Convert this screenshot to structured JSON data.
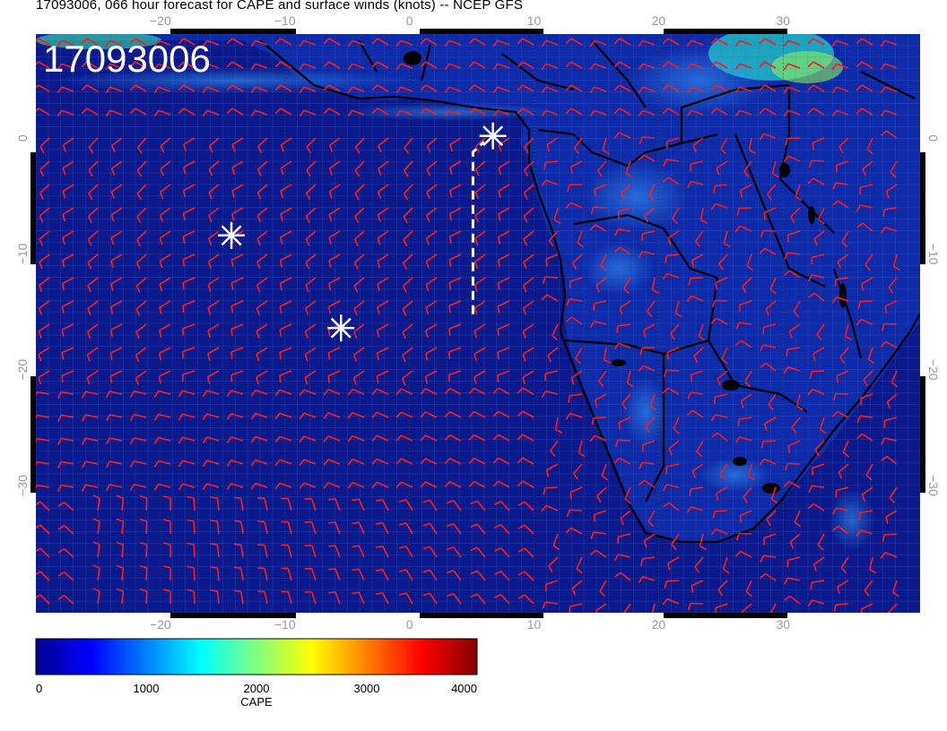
{
  "title": "17093006, 066 hour forecast for CAPE and surface winds (knots) -- NCEP GFS",
  "stamp": "17093006",
  "map": {
    "lon_range": [
      -30,
      41
    ],
    "lat_range": [
      -41,
      9
    ],
    "lon_ticks": [
      "−20",
      "−10",
      "0",
      "10",
      "20",
      "30"
    ],
    "lat_ticks": [
      "0",
      "−10",
      "−20",
      "−30"
    ],
    "ocean_color": "#0a1a8c",
    "land_color": "#0d2aa8",
    "barb_color": "#ff1a1a",
    "coast_color": "#000000",
    "storm_markers": [
      {
        "lon": -14.3,
        "lat": -8.4
      },
      {
        "lon": -5.5,
        "lat": -16.4
      },
      {
        "lon": 6.7,
        "lat": 0.2
      }
    ],
    "track": [
      {
        "lon": 5.1,
        "lat": -15.2
      },
      {
        "lon": 5.1,
        "lat": -1.2
      },
      {
        "lon": 6.0,
        "lat": -0.3
      }
    ]
  },
  "colorbar": {
    "title": "CAPE",
    "ticks": [
      "0",
      "1000",
      "2000",
      "3000",
      "4000"
    ],
    "colors": [
      "#00008f",
      "#0000ff",
      "#0080ff",
      "#00ffff",
      "#80ff80",
      "#ffff00",
      "#ff8000",
      "#ff0000",
      "#800000"
    ]
  }
}
